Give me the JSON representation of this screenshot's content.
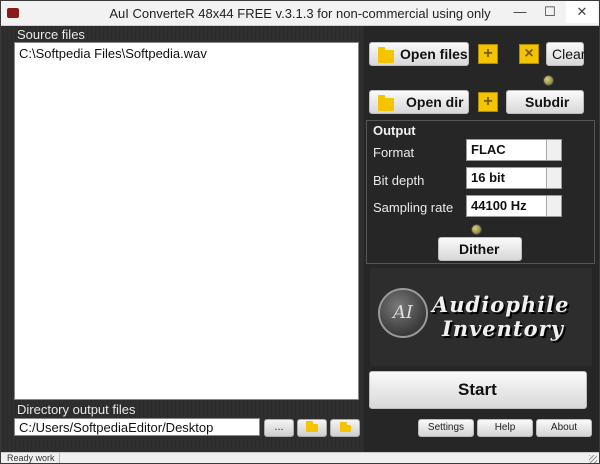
{
  "window": {
    "title": "AuI ConverteR 48x44 FREE v.3.1.3 for non-commercial using only",
    "minimize": "—",
    "maximize": "☐",
    "close": "✕"
  },
  "left": {
    "source_label": "Source files",
    "files": [
      "C:\\Softpedia Files\\Softpedia.wav"
    ],
    "output_label": "Directory output files",
    "output_path": "C:/Users/SoftpediaEditor/Desktop",
    "browse_label": "..."
  },
  "right": {
    "open_files": "Open files",
    "add_symbol": "+",
    "remove_symbol": "×",
    "clear": "Clear",
    "open_dir": "Open dir",
    "subdir": "Subdir",
    "output_title": "Output",
    "format_label": "Format",
    "format_value": "FLAC",
    "bitdepth_label": "Bit depth",
    "bitdepth_value": "16 bit",
    "samplerate_label": "Sampling rate",
    "samplerate_value": "44100 Hz",
    "dither": "Dither",
    "logo_mono": "AI",
    "logo_line1": "Audiophile",
    "logo_line2": "Inventory",
    "start": "Start",
    "settings": "Settings",
    "help": "Help",
    "about": "About"
  },
  "status": {
    "text": "Ready work"
  }
}
